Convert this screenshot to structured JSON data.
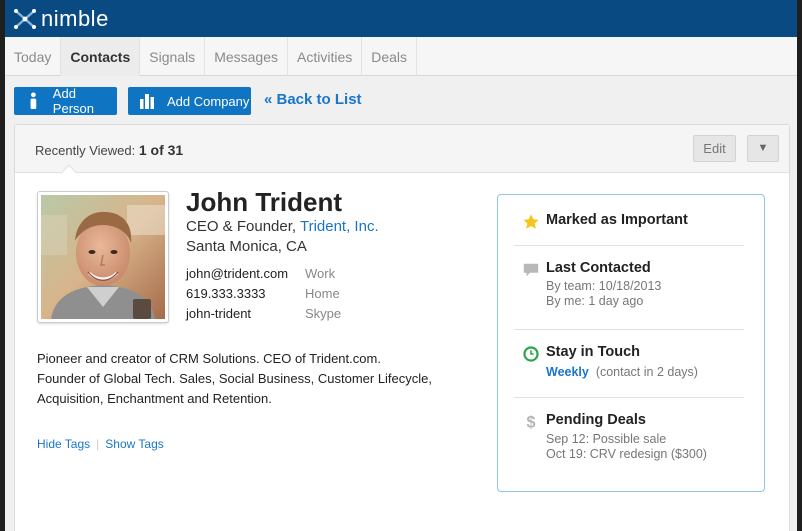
{
  "app": {
    "name": "nimble"
  },
  "tabs": [
    {
      "label": "Today",
      "active": false
    },
    {
      "label": "Contacts",
      "active": true
    },
    {
      "label": "Signals",
      "active": false
    },
    {
      "label": "Messages",
      "active": false
    },
    {
      "label": "Activities",
      "active": false
    },
    {
      "label": "Deals",
      "active": false
    }
  ],
  "toolbar": {
    "add_person_label": "Add Person",
    "add_company_label": "Add Company",
    "back_label": "« Back to List"
  },
  "card_header": {
    "recently_viewed_label": "Recently Viewed:",
    "recently_viewed_value": "1 of 31",
    "edit_label": "Edit",
    "dropdown_glyph": "▼"
  },
  "contact": {
    "name": "John Trident",
    "title_prefix": "CEO & Founder,",
    "company": "Trident, Inc.",
    "location": "Santa Monica, CA",
    "contacts": [
      {
        "value": "john@trident.com",
        "type": "Work"
      },
      {
        "value": "619.333.3333",
        "type": "Home"
      },
      {
        "value": "john-trident",
        "type": "Skype"
      }
    ],
    "bio": [
      "Pioneer and creator of CRM Solutions. CEO of Trident.com.",
      "Founder of Global Tech. Sales, Social Business, Customer Lifecycle,",
      "Acquisition, Enchantment and Retention."
    ],
    "hide_tags_label": "Hide Tags",
    "show_tags_label": "Show Tags"
  },
  "sidebar": {
    "important": {
      "title": "Marked as Important"
    },
    "last_contacted": {
      "title": "Last Contacted",
      "by_team": "By team:  10/18/2013",
      "by_me": "By me:  1 day ago"
    },
    "stay_in_touch": {
      "title": "Stay in Touch",
      "frequency": "Weekly",
      "detail": "(contact in 2 days)"
    },
    "pending_deals": {
      "title": "Pending Deals",
      "deals": [
        "Sep 12:  Possible sale",
        "Oct 19:  CRV redesign ($300)"
      ]
    }
  },
  "colors": {
    "header_bg": "#0a4a82",
    "primary_button": "#0f74c2",
    "link": "#1976c8",
    "star": "#f5c518",
    "clock_green": "#2ea44f",
    "sidebar_border": "#8ec5e8"
  }
}
